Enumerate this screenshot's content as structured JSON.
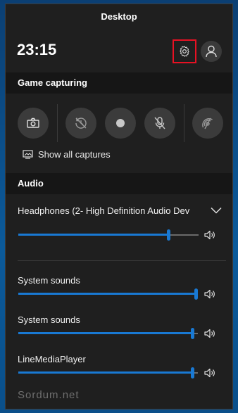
{
  "header": {
    "title": "Desktop",
    "clock": "23:15"
  },
  "game_capturing": {
    "title": "Game capturing",
    "show_all_captures": "Show all captures"
  },
  "audio": {
    "title": "Audio",
    "device_name": "Headphones (2- High Definition Audio Dev",
    "device_volume": 0.84,
    "apps": [
      {
        "name": "System sounds",
        "volume": 1.0
      },
      {
        "name": "System sounds",
        "volume": 0.98
      },
      {
        "name": "LineMediaPlayer",
        "volume": 0.98
      }
    ]
  },
  "watermark": "Sordum.net",
  "colors": {
    "accent": "#1979d3",
    "highlight_border": "#e81123",
    "panel_bg": "#1f1f1f"
  }
}
